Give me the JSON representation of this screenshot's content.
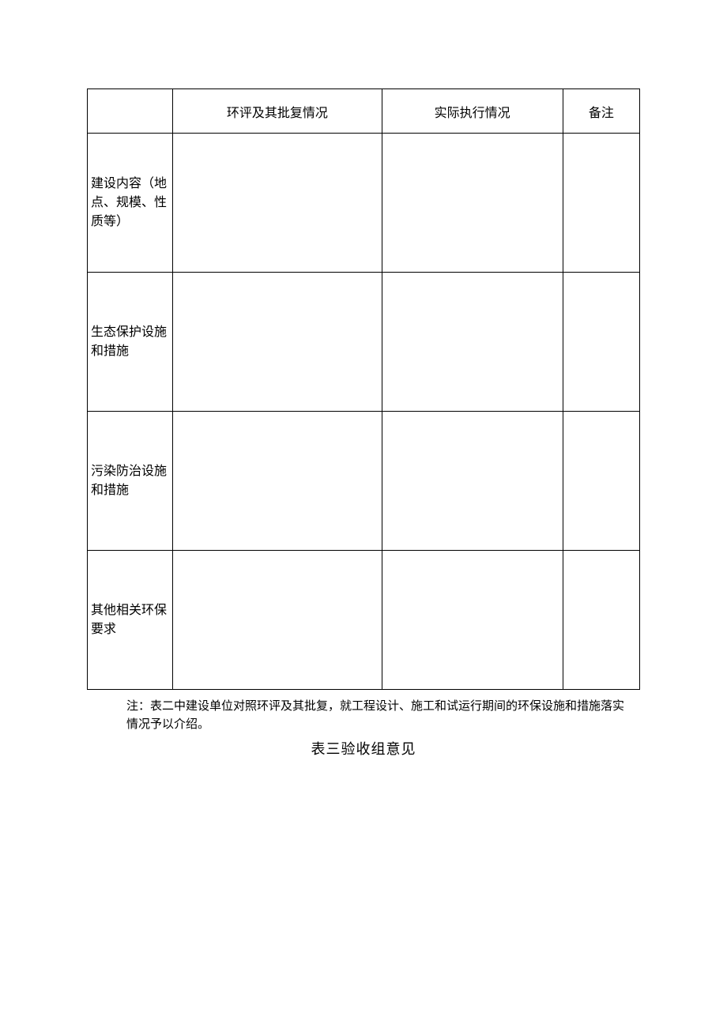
{
  "table": {
    "headers": {
      "col1": "",
      "col2": "环评及其批复情况",
      "col3": "实际执行情况",
      "col4": "备注"
    },
    "rows": [
      {
        "label": "建设内容（地点、规模、性质等）",
        "c2": "",
        "c3": "",
        "c4": ""
      },
      {
        "label": "生态保护设施和措施",
        "c2": "",
        "c3": "",
        "c4": ""
      },
      {
        "label": "污染防治设施和措施",
        "c2": "",
        "c3": "",
        "c4": ""
      },
      {
        "label": "其他相关环保要求",
        "c2": "",
        "c3": "",
        "c4": ""
      }
    ]
  },
  "note": "注：表二中建设单位对照环评及其批复，就工程设计、施工和试运行期间的环保设施和措施落实情况予以介绍。",
  "section_title": "表三验收组意见"
}
